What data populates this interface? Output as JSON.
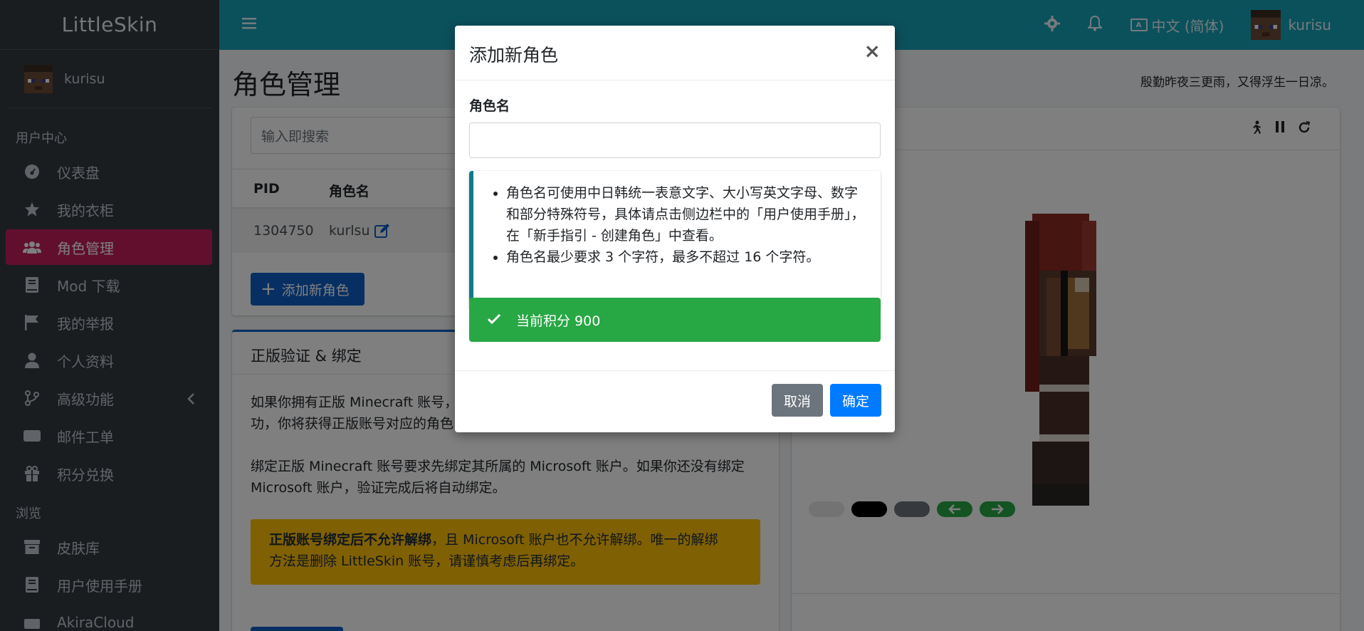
{
  "brand": "LittleSkin",
  "sidebar": {
    "username": "kurisu",
    "section_user": "用户中心",
    "section_browse": "浏览",
    "items": [
      {
        "label": "仪表盘",
        "icon": "dashboard-icon"
      },
      {
        "label": "我的衣柜",
        "icon": "star-icon"
      },
      {
        "label": "角色管理",
        "icon": "users-icon"
      },
      {
        "label": "Mod 下载",
        "icon": "book-icon"
      },
      {
        "label": "我的举报",
        "icon": "flag-icon"
      },
      {
        "label": "个人资料",
        "icon": "user-icon"
      },
      {
        "label": "高级功能",
        "icon": "code-branch-icon"
      },
      {
        "label": "邮件工单",
        "icon": "ticket-icon"
      },
      {
        "label": "积分兑换",
        "icon": "gift-icon"
      }
    ],
    "browse_items": [
      {
        "label": "皮肤库",
        "icon": "archive-icon"
      },
      {
        "label": "用户使用手册",
        "icon": "book-icon"
      },
      {
        "label": "AkiraCloud",
        "icon": "cloud-icon"
      }
    ]
  },
  "topbar": {
    "language": "中文 (简体)",
    "username": "kurisu"
  },
  "page": {
    "title": "角色管理",
    "quote": "殷勤昨夜三更雨，又得浮生一日凉。"
  },
  "players": {
    "search_placeholder": "输入即搜索",
    "col_pid": "PID",
    "col_name": "角色名",
    "rows": [
      {
        "pid": "1304750",
        "name": "kurlsu"
      }
    ],
    "add_button": "添加新角色"
  },
  "verify": {
    "title": "正版验证 & 绑定",
    "p1_line1": "如果你拥有正版 Minecraft 账号，",
    "p1_line2": "功，你将获得正版账号对应的角色",
    "p2_line1": "绑定正版 Minecraft 账号要求先绑定其所属的 Microsoft 账户。如果你还没有绑定",
    "p2_line2": "Microsoft 账户，验证完成后将自动绑定。",
    "warn_bold": "正版账号绑定后不允许解绑",
    "warn_rest1": "，且 Microsoft 账户也不允许解绑。唯一的解绑",
    "warn_line2": "方法是删除 LittleSkin 账号，请谨慎考虑后再绑定。"
  },
  "modal": {
    "title": "添加新角色",
    "close": "×",
    "field_label": "角色名",
    "field_value": "",
    "rule1": "角色名可使用中日韩统一表意文字、大小写英文字母、数字和部分特殊符号，具体请点击侧边栏中的「用户使用手册」，在「新手指引 - 创建角色」中查看。",
    "rule2": "角色名最少要求 3 个字符，最多不超过 16 个字符。",
    "score": "当前积分 900",
    "cancel": "取消",
    "confirm": "确定"
  },
  "colors": {
    "sidebar_bg": "#343a40",
    "topbar_bg": "#17a2b8",
    "active_item": "#c51f5d",
    "primary": "#007bff",
    "success": "#28a745",
    "warning": "#ffc107"
  }
}
